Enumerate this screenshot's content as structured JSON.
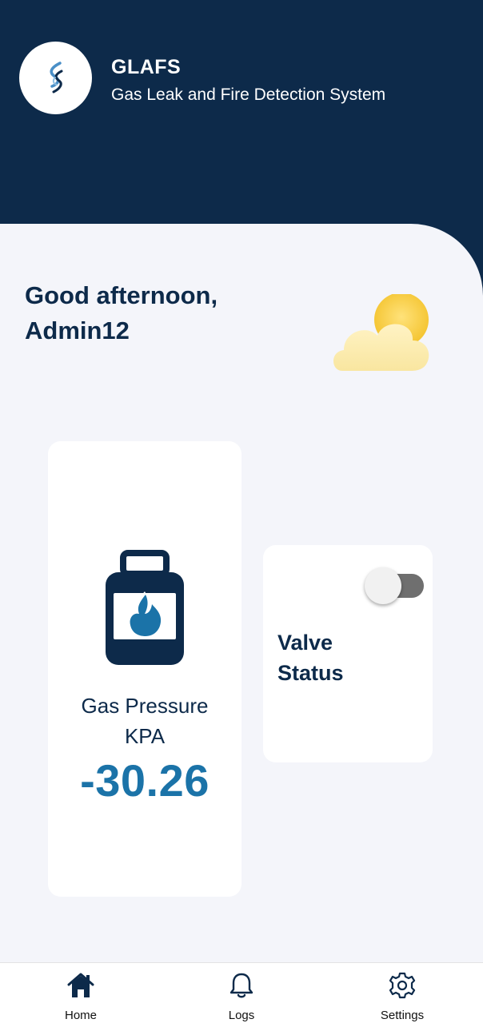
{
  "header": {
    "title": "GLAFS",
    "subtitle": "Gas Leak and Fire Detection System",
    "logo_icon": "glafs-flame-logo"
  },
  "greeting": {
    "line1": "Good afternoon,",
    "line2": "Admin12",
    "weather_icon": "partly-cloudy-icon"
  },
  "gas_card": {
    "icon": "gas-tank-icon",
    "label_line1": "Gas Pressure",
    "label_line2": "KPA",
    "value": "-30.26"
  },
  "valve_card": {
    "label_line1": "Valve",
    "label_line2": "Status",
    "toggle_on": false
  },
  "bottom_nav": {
    "items": [
      {
        "label": "Home",
        "icon": "home-icon",
        "active": true
      },
      {
        "label": "Logs",
        "icon": "bell-icon",
        "active": false
      },
      {
        "label": "Settings",
        "icon": "gear-icon",
        "active": false
      }
    ]
  },
  "colors": {
    "primary": "#0d2a4a",
    "value": "#1b73a8",
    "background": "#f4f5fa"
  }
}
